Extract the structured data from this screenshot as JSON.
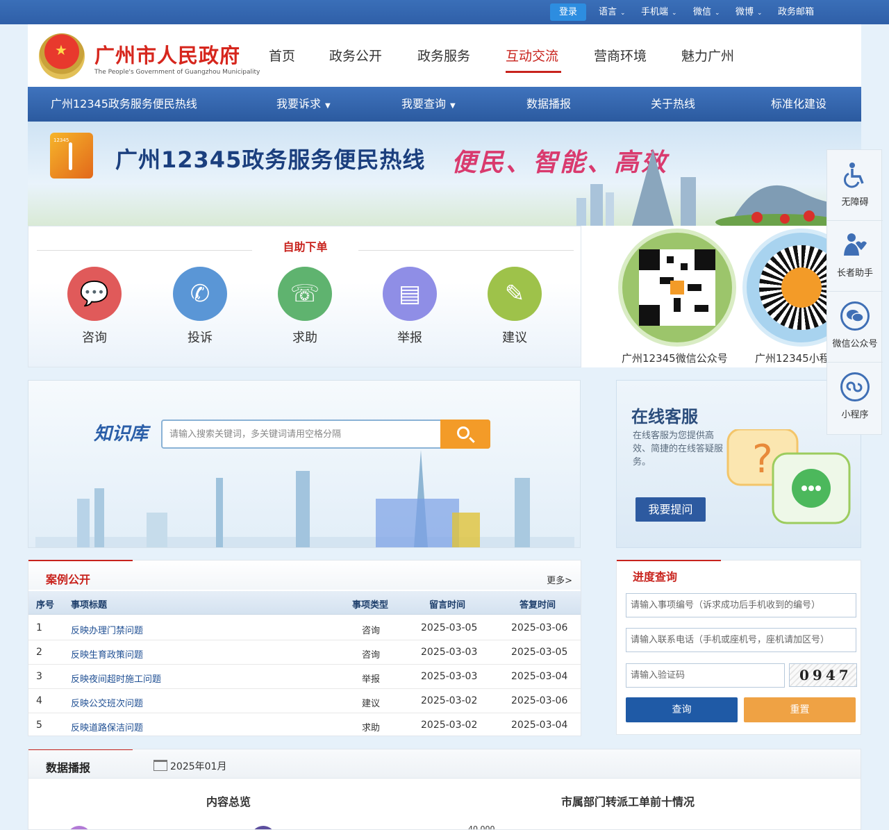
{
  "topbar": {
    "login": "登录",
    "items": [
      "语言",
      "手机端",
      "微信",
      "微博",
      "政务邮箱"
    ]
  },
  "header": {
    "title": "广州市人民政府",
    "subtitle": "The People's Government of Guangzhou Municipality",
    "nav": [
      "首页",
      "政务公开",
      "政务服务",
      "互动交流",
      "营商环境",
      "魅力广州"
    ],
    "active_nav": "互动交流"
  },
  "subnav": {
    "title": "广州12345政务服务便民热线",
    "items": [
      "我要诉求",
      "我要查询",
      "数据播报",
      "关于热线",
      "标准化建设"
    ]
  },
  "banner": {
    "logo_text": "12345",
    "title": "广州12345政务服务便民热线",
    "slogan": "便民、智能、高效"
  },
  "self_order": {
    "title": "自助下单",
    "services": [
      {
        "label": "咨询",
        "color": "#e05a5a",
        "icon": "chat-bubbles-icon"
      },
      {
        "label": "投诉",
        "color": "#5a96d6",
        "icon": "phone-icon"
      },
      {
        "label": "求助",
        "color": "#5fb36f",
        "icon": "help-chat-icon"
      },
      {
        "label": "举报",
        "color": "#8f8ee6",
        "icon": "document-icon"
      },
      {
        "label": "建议",
        "color": "#9ec24a",
        "icon": "edit-icon"
      }
    ]
  },
  "qr": {
    "wechat_label": "广州12345微信公众号",
    "mini_label": "广州12345小程序"
  },
  "knowledge": {
    "title": "知识库",
    "placeholder": "请输入搜索关键词，多关键词请用空格分隔"
  },
  "online_service": {
    "title": "在线客服",
    "desc": "在线客服为您提供高效、简捷的在线答疑服务。",
    "button": "我要提问"
  },
  "cases": {
    "title": "案例公开",
    "more": "更多>",
    "headers": [
      "序号",
      "事项标题",
      "事项类型",
      "留言时间",
      "答复时间"
    ],
    "rows": [
      {
        "no": "1",
        "title": "反映办理门禁问题",
        "type": "咨询",
        "asked": "2025-03-05",
        "answered": "2025-03-06"
      },
      {
        "no": "2",
        "title": "反映生育政策问题",
        "type": "咨询",
        "asked": "2025-03-03",
        "answered": "2025-03-05"
      },
      {
        "no": "3",
        "title": "反映夜间超时施工问题",
        "type": "举报",
        "asked": "2025-03-03",
        "answered": "2025-03-04"
      },
      {
        "no": "4",
        "title": "反映公交班次问题",
        "type": "建议",
        "asked": "2025-03-02",
        "answered": "2025-03-06"
      },
      {
        "no": "5",
        "title": "反映道路保洁问题",
        "type": "求助",
        "asked": "2025-03-02",
        "answered": "2025-03-04"
      }
    ]
  },
  "progress": {
    "title": "进度查询",
    "ph_id": "请输入事项编号（诉求成功后手机收到的编号）",
    "ph_phone": "请输入联系电话（手机或座机号，座机请加区号）",
    "ph_code": "请输入验证码",
    "captcha": "0947",
    "query": "查询",
    "reset": "重置"
  },
  "data_broadcast": {
    "title": "数据播报",
    "date": "2025年01月",
    "overview": "内容总览",
    "top10": "市属部门转派工单前十情况",
    "tick": "40,000"
  },
  "floatbar": {
    "items": [
      {
        "label": "无障碍",
        "icon": "wheelchair-icon"
      },
      {
        "label": "长者助手",
        "icon": "elder-helper-icon"
      },
      {
        "label": "微信公众号",
        "icon": "wechat-icon"
      },
      {
        "label": "小程序",
        "icon": "mini-program-icon"
      }
    ]
  },
  "colors": {
    "brand_blue": "#2f5fa8",
    "brand_red": "#c8231d",
    "accent_orange": "#f39b28"
  }
}
